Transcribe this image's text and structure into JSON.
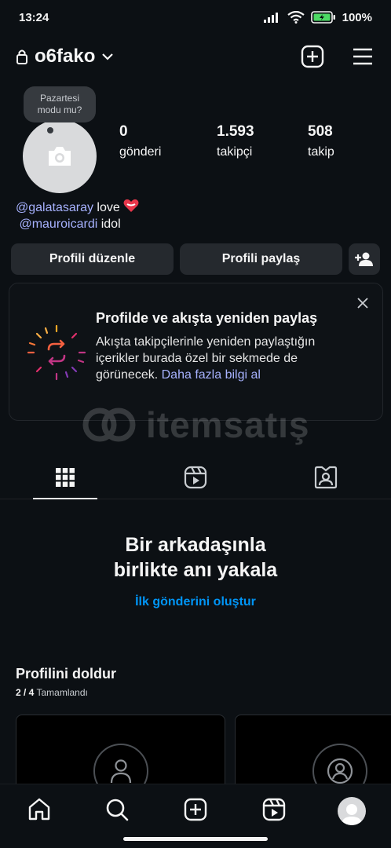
{
  "status_bar": {
    "time": "13:24",
    "battery": "100%"
  },
  "header": {
    "username": "o6fako"
  },
  "profile": {
    "note": "Pazartesi modu mu?",
    "stats": [
      {
        "value": "0",
        "label": "gönderi"
      },
      {
        "value": "1.593",
        "label": "takipçi"
      },
      {
        "value": "508",
        "label": "takip"
      }
    ],
    "bio": {
      "line1_mention": "@galatasaray",
      "line1_text": " love",
      "line2_mention": "@mauroicardi",
      "line2_text": "  idol"
    }
  },
  "actions": {
    "edit": "Profili düzenle",
    "share": "Profili paylaş"
  },
  "reshare_card": {
    "title": "Profilde ve akışta yeniden paylaş",
    "body": "Akışta takipçilerinle yeniden paylaştığın içerikler burada özel bir sekmede de görünecek.",
    "link": "Daha fazla bilgi al"
  },
  "watermark": {
    "text": "itemsatış"
  },
  "empty_state": {
    "title_line1": "Bir arkadaşınla",
    "title_line2": "birlikte anı yakala",
    "cta": "İlk gönderini oluştur"
  },
  "complete_profile": {
    "title": "Profilini doldur",
    "progress": "2 / 4",
    "status": "Tamamlandı"
  },
  "colors": {
    "background": "#0c1014",
    "accent_link": "#0095f6",
    "mention": "#a7b2ff",
    "button": "#25292e"
  }
}
